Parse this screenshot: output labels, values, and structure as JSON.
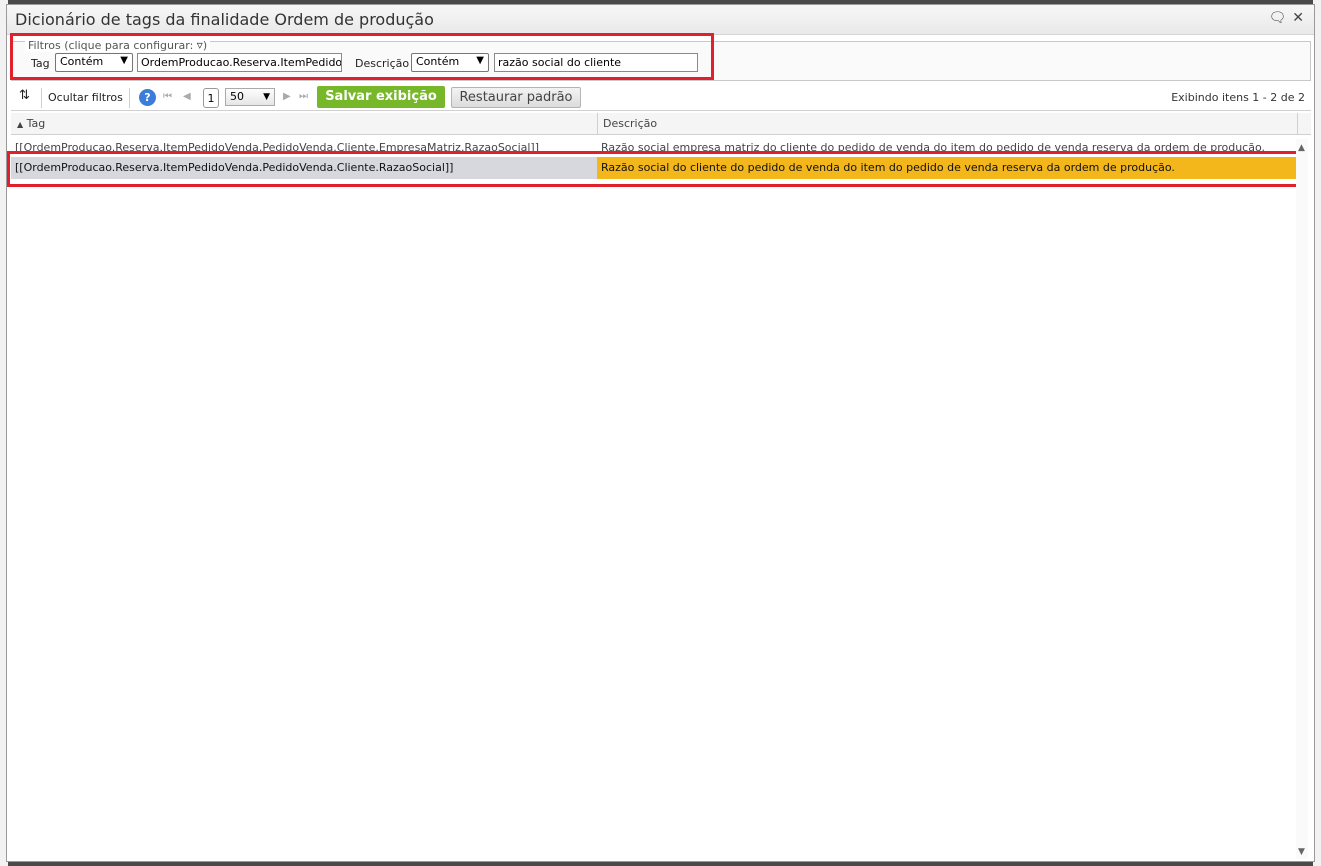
{
  "window": {
    "title": "Dicionário de tags da finalidade Ordem de produção"
  },
  "filters": {
    "legend": "Filtros (clique para configurar:",
    "legend_close": ")",
    "tag_label": "Tag",
    "tag_operator": "Contém",
    "tag_value": "OrdemProducao.Reserva.ItemPedidoV",
    "desc_label": "Descrição",
    "desc_operator": "Contém",
    "desc_value": "razão social do cliente"
  },
  "toolbar": {
    "hide_filters": "Ocultar filtros",
    "help": "?",
    "page": "1",
    "page_size": "50",
    "save_view": "Salvar exibição",
    "restore_default": "Restaurar padrão",
    "status": "Exibindo itens 1 - 2 de 2"
  },
  "grid": {
    "columns": [
      "Tag",
      "Descrição"
    ],
    "rows": [
      {
        "tag": "[[OrdemProducao.Reserva.ItemPedidoVenda.PedidoVenda.Cliente.EmpresaMatriz.RazaoSocial]]",
        "desc": "Razão social empresa matriz do cliente do pedido de venda do item do pedido de venda reserva da ordem de produção."
      },
      {
        "tag": "[[OrdemProducao.Reserva.ItemPedidoVenda.PedidoVenda.Cliente.RazaoSocial]]",
        "desc": "Razão social do cliente do pedido de venda do item do pedido de venda reserva da ordem de produção."
      }
    ]
  },
  "colors": {
    "highlight": "#f3b61b",
    "save_button": "#77b82a",
    "annotation": "#e0202a"
  }
}
